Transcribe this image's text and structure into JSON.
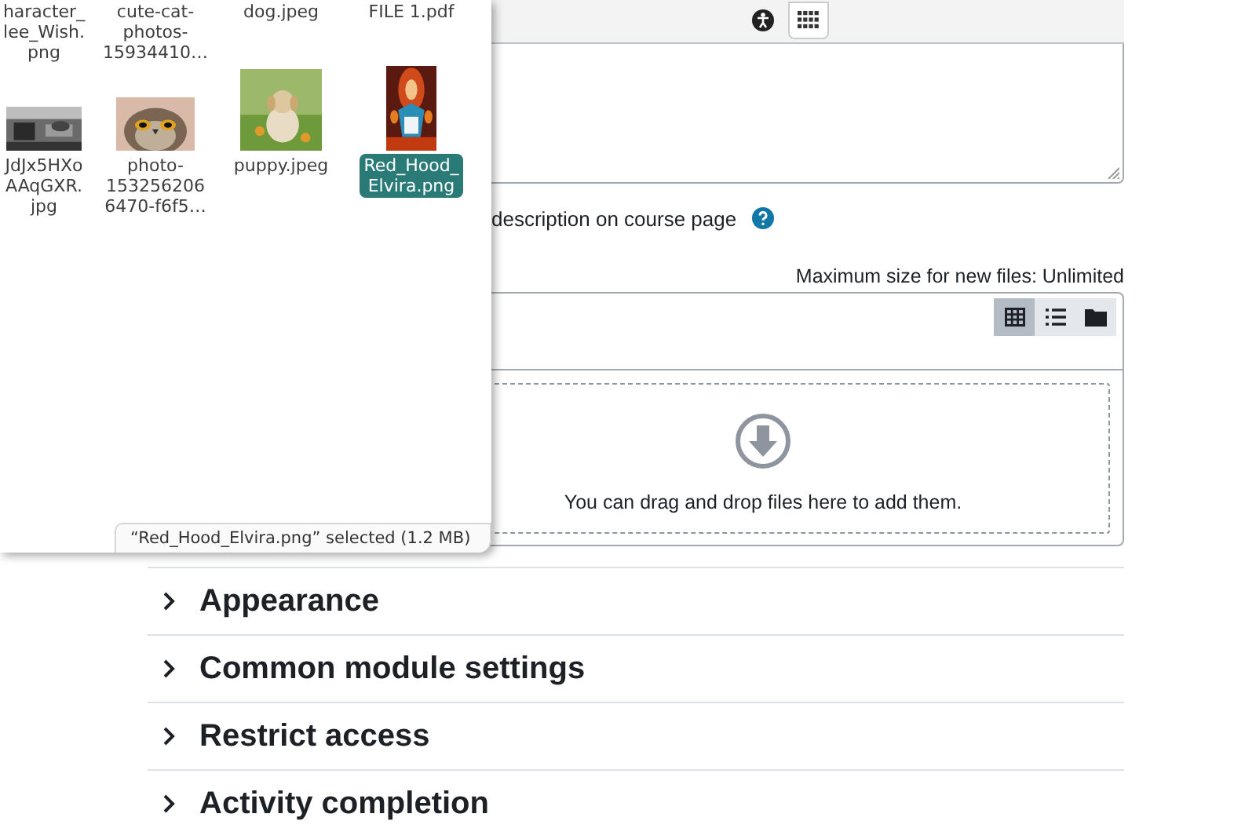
{
  "show_description": {
    "label": "description on course page"
  },
  "files": {
    "max_size": "Maximum size for new files: Unlimited",
    "view_buttons": [
      {
        "kind": "grid",
        "selected": true
      },
      {
        "kind": "list",
        "selected": false
      },
      {
        "kind": "tree",
        "selected": false
      }
    ],
    "dropzone": "You can drag and drop files here to add them."
  },
  "sections": [
    {
      "title": "Appearance",
      "expanded": false
    },
    {
      "title": "Common module settings",
      "expanded": false
    },
    {
      "title": "Restrict access",
      "expanded": false
    },
    {
      "title": "Activity completion",
      "expanded": false
    }
  ],
  "file_dialog": {
    "items": [
      {
        "lines": [
          "haracter_",
          "lee_Wish.",
          "png"
        ],
        "kind": "none",
        "selected": false
      },
      {
        "lines": [
          "cute-cat-",
          "photos-",
          "15934410…"
        ],
        "kind": "none",
        "selected": false
      },
      {
        "lines": [
          "dog.jpeg"
        ],
        "kind": "none",
        "selected": false
      },
      {
        "lines": [
          "FILE 1.pdf"
        ],
        "kind": "none",
        "selected": false
      },
      {
        "lines": [
          "JdJx5HXo",
          "AAqGXR.",
          "jpg"
        ],
        "kind": "gray",
        "selected": false
      },
      {
        "lines": [
          "photo-",
          "153256206",
          "6470-f6f5…"
        ],
        "kind": "owl",
        "selected": false
      },
      {
        "lines": [
          "puppy.jpeg"
        ],
        "kind": "puppy",
        "selected": false
      },
      {
        "lines": [
          "Red_Hood_",
          "Elvira.png"
        ],
        "kind": "poster",
        "selected": true
      }
    ],
    "status": "“Red_Hood_Elvira.png” selected  (1.2 MB)"
  }
}
